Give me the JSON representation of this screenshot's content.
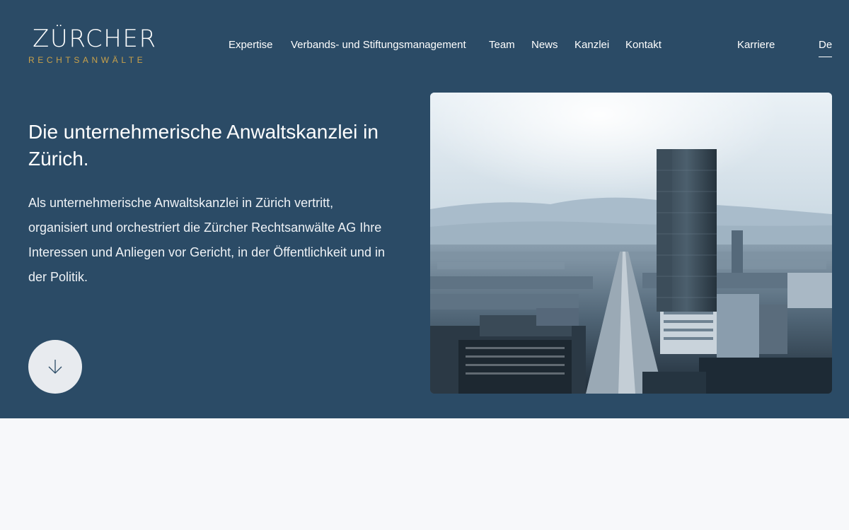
{
  "brand": {
    "name": "ZÜRCHER",
    "subtitle": "RECHTSANWÄLTE",
    "accent_color": "#c9a14a"
  },
  "nav": {
    "items": [
      {
        "label": "Expertise"
      },
      {
        "label": "Verbands- und Stiftungsmanagement"
      },
      {
        "label": "Team"
      },
      {
        "label": "News"
      },
      {
        "label": "Kanzlei"
      },
      {
        "label": "Kontakt"
      }
    ],
    "careers": "Karriere",
    "language": "De"
  },
  "hero": {
    "background_color": "#2b4b66",
    "headline": "Die unternehmerische Anwaltskanzlei in Zürich.",
    "intro": "Als unternehmerische Anwaltskanzlei in Zürich vertritt, organisiert und orchestriert die Zürcher Rechtsanwälte AG Ihre Interessen und Anliegen vor Gericht, in der Öffentlichkeit und in der Politik.",
    "scroll_icon": "arrow-down-icon",
    "image_subject": "Zürich skyline photo"
  }
}
